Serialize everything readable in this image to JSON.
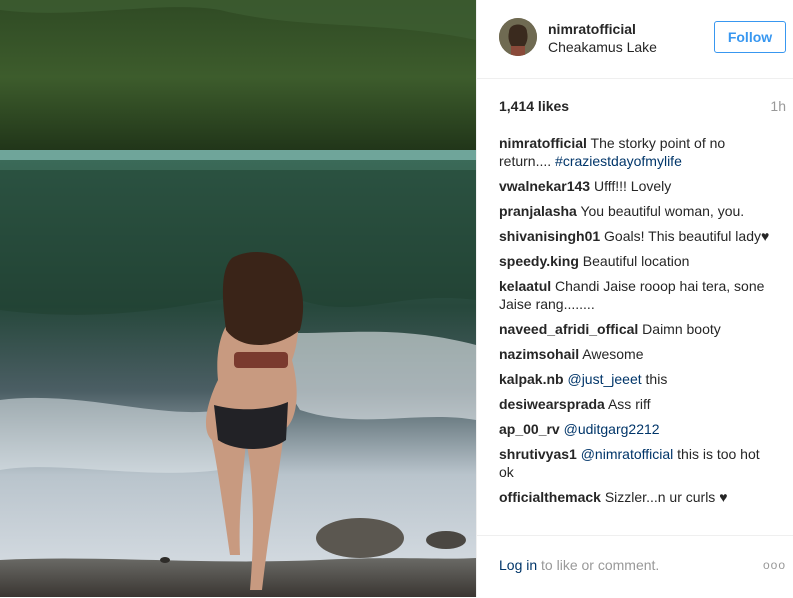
{
  "post": {
    "username": "nimratofficial",
    "location": "Cheakamus Lake",
    "follow_label": "Follow",
    "likes": "1,414 likes",
    "time": "1h"
  },
  "comments": [
    {
      "user": "nimratofficial",
      "text": "The storky point of no return.... ",
      "link": "#craziestdayofmylife"
    },
    {
      "user": "vwalnekar143",
      "text": "Ufff!!! Lovely"
    },
    {
      "user": "pranjalasha",
      "text": "You beautiful woman, you."
    },
    {
      "user": "shivanisingh01",
      "text": "Goals! This beautiful lady",
      "heart": "♥"
    },
    {
      "user": "speedy.king",
      "text": "Beautiful location"
    },
    {
      "user": "kelaatul",
      "text": "Chandi Jaise rooop hai tera, sone Jaise rang........"
    },
    {
      "user": "naveed_afridi_offical",
      "text": "Daimn booty"
    },
    {
      "user": "nazimsohail",
      "text": "Awesome"
    },
    {
      "user": "kalpak.nb",
      "link": "@just_jeeet",
      "text_after": " this"
    },
    {
      "user": "desiwearsprada",
      "text": "Ass riff"
    },
    {
      "user": "ap_00_rv",
      "link": "@uditgarg2212"
    },
    {
      "user": "shrutivyas1",
      "link": "@nimratofficial",
      "text_after": " this is too hot ok"
    },
    {
      "user": "officialthemack",
      "text": "Sizzler...n ur curls ",
      "heart": "♥"
    }
  ],
  "footer": {
    "login_link": "Log in",
    "login_text": " to like or comment.",
    "more": "ooo"
  }
}
